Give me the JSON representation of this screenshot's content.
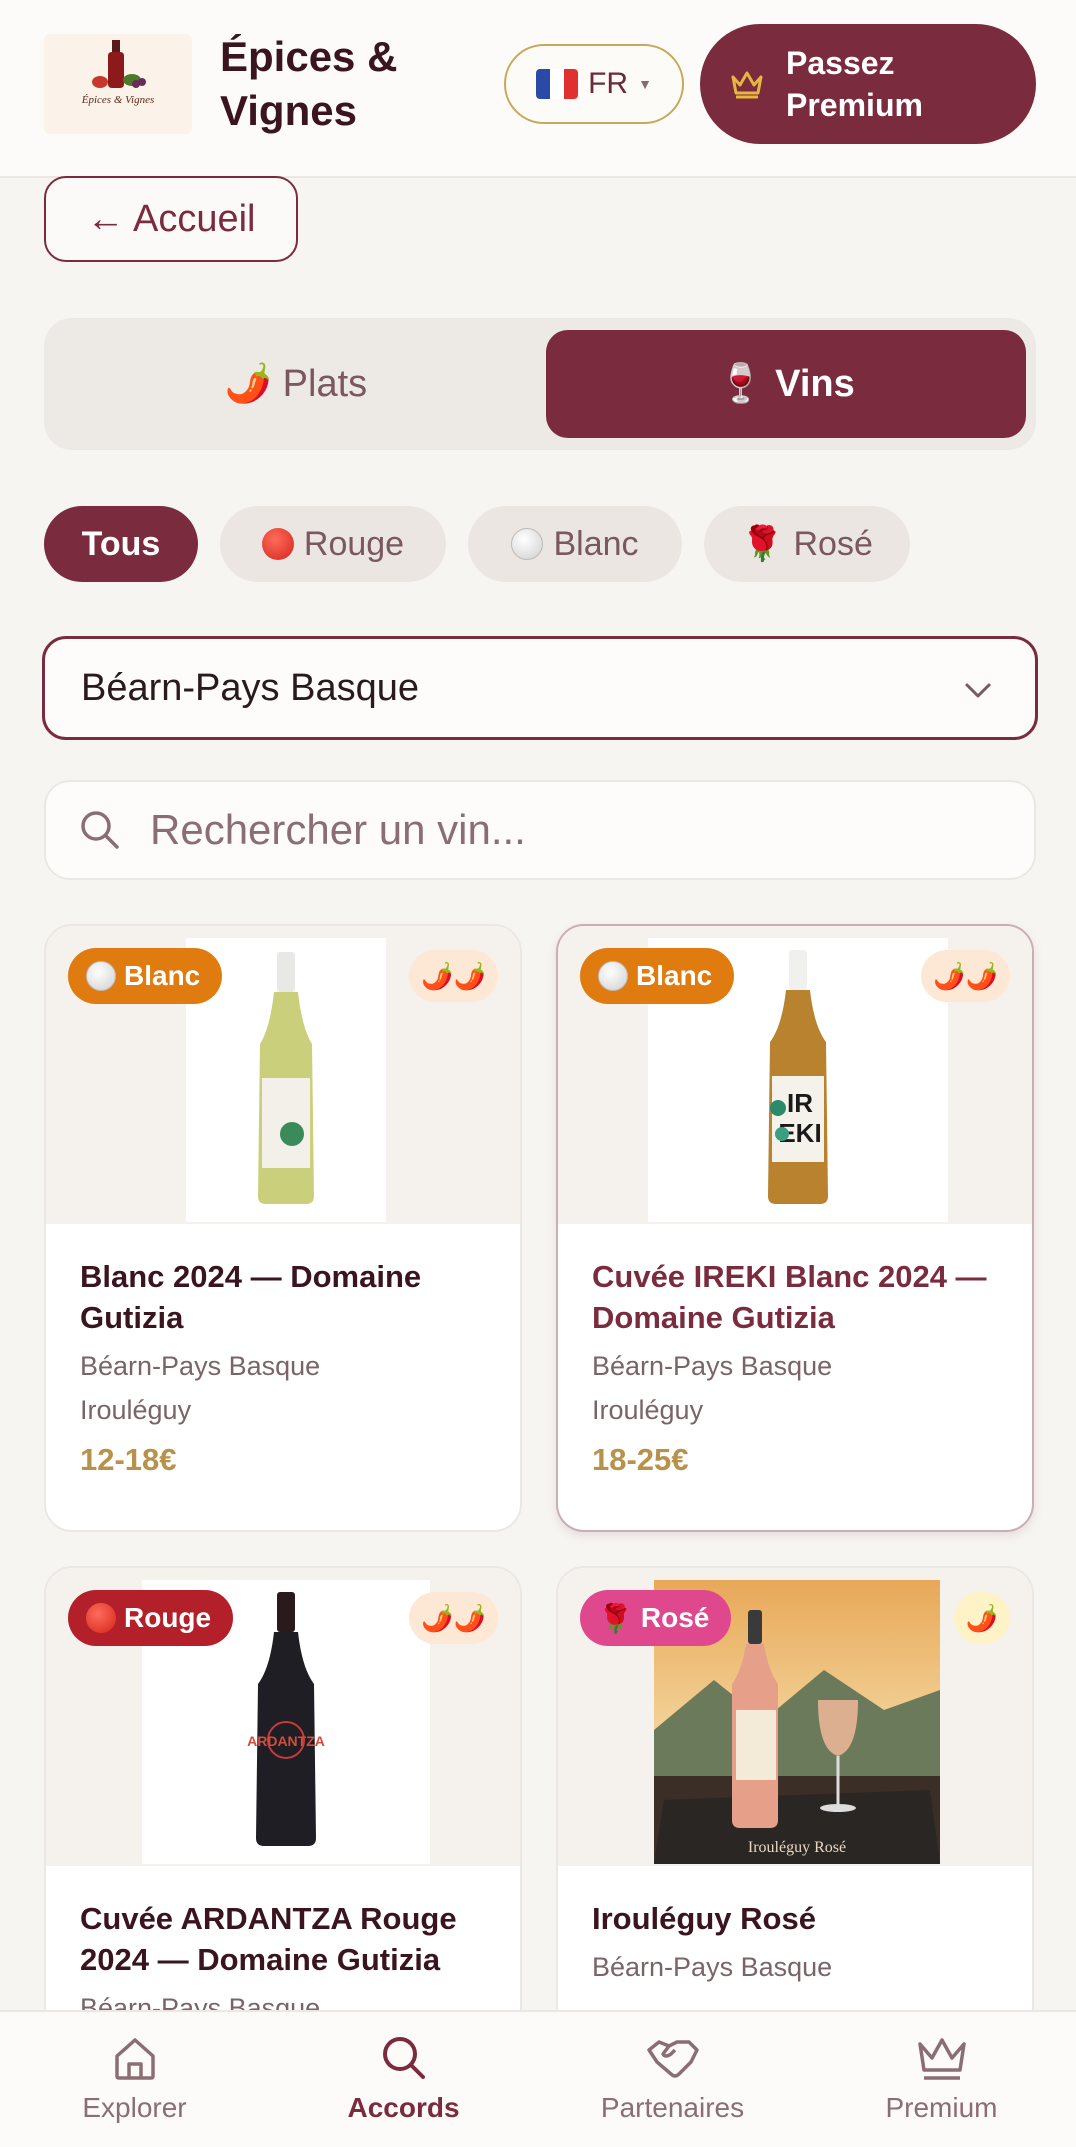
{
  "header": {
    "logo_text": "Épices & Vignes",
    "title": "Épices & Vignes",
    "language": "FR",
    "premium_label": "Passez Premium"
  },
  "back_button": "← Accueil",
  "segments": {
    "plats": "🌶️ Plats",
    "vins": "🍷 Vins",
    "active": "vins"
  },
  "filters": [
    {
      "label": "Tous",
      "active": true
    },
    {
      "label": "Rouge",
      "icon": "red-dot"
    },
    {
      "label": "Blanc",
      "icon": "white-dot"
    },
    {
      "label": "Rosé",
      "icon": "rose-emoji"
    }
  ],
  "region_select": {
    "value": "Béarn-Pays Basque"
  },
  "search": {
    "placeholder": "Rechercher un vin..."
  },
  "wines": [
    {
      "name": "Blanc 2024 — Domaine Gutizia",
      "region": "Béarn-Pays Basque",
      "appellation": "Irouléguy",
      "price": "12-18€",
      "type": "Blanc",
      "type_color": "#e07b10",
      "spice": "🌶️🌶️"
    },
    {
      "name": "Cuvée IREKI Blanc 2024 — Domaine Gutizia",
      "region": "Béarn-Pays Basque",
      "appellation": "Irouléguy",
      "price": "18-25€",
      "type": "Blanc",
      "type_color": "#e07b10",
      "spice": "🌶️🌶️"
    },
    {
      "name": "Cuvée ARDANTZA Rouge 2024 — Domaine Gutizia",
      "region": "Béarn-Pays Basque",
      "appellation": "",
      "price": "",
      "type": "Rouge",
      "type_color": "#b4202a",
      "spice": "🌶️🌶️"
    },
    {
      "name": "Irouléguy Rosé",
      "region": "Béarn-Pays Basque",
      "appellation": "",
      "price": "",
      "type": "Rosé",
      "type_color": "#e0488e",
      "spice": "🌶️",
      "image_caption": "Irouléguy Rosé"
    }
  ],
  "bottom_nav": [
    {
      "label": "Explorer",
      "icon": "home-icon"
    },
    {
      "label": "Accords",
      "icon": "search-icon",
      "active": true
    },
    {
      "label": "Partenaires",
      "icon": "handshake-icon"
    },
    {
      "label": "Premium",
      "icon": "crown-icon"
    }
  ],
  "colors": {
    "brand": "#7a2c3e",
    "gold": "#b8924a",
    "background": "#f7f5f2"
  }
}
